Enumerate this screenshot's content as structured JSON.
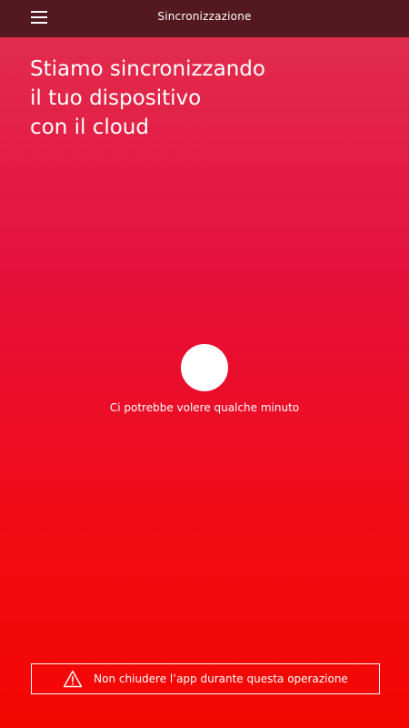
{
  "header": {
    "title": "Sincronizzazione",
    "menu_icon": "hamburger-menu-icon"
  },
  "main": {
    "headline_lines": [
      "Stiamo sincronizzando",
      "il tuo dispositivo",
      "con il cloud"
    ],
    "status_text": "Ci potrebbe volere qualche minuto"
  },
  "footer": {
    "warning_icon": "warning-triangle-icon",
    "warning_text": "Non chiudere l’app durante questa operazione"
  },
  "colors": {
    "topbar": "#541820",
    "gradient_top": "#e03050",
    "gradient_bottom": "#f40600",
    "text": "#ffffff"
  }
}
